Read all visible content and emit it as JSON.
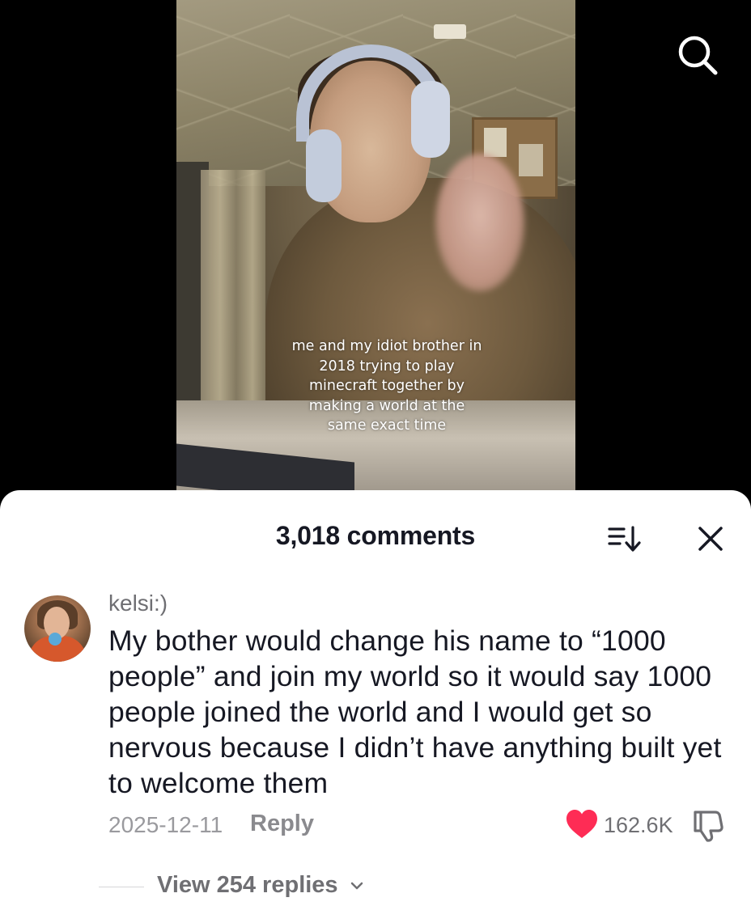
{
  "video": {
    "caption_lines": [
      "me and my idiot brother in",
      "2018 trying to play",
      "minecraft together by",
      "making a world at the",
      "same exact time"
    ]
  },
  "top_bar": {
    "search_icon": "search-icon"
  },
  "comments_panel": {
    "title": "3,018 comments",
    "sort_icon": "sort-icon",
    "close_icon": "close-icon",
    "comment": {
      "username": "kelsi:)",
      "text": "My bother would change his name to “1000 people” and join my world so it would say 1000 people joined the world and I would get so nervous because I didn’t have anything built yet to welcome them",
      "date": "2025-12-11",
      "reply_label": "Reply",
      "like_count": "162.6K",
      "liked": true,
      "like_color": "#fe2c55"
    },
    "view_replies_label": "View 254 replies"
  }
}
